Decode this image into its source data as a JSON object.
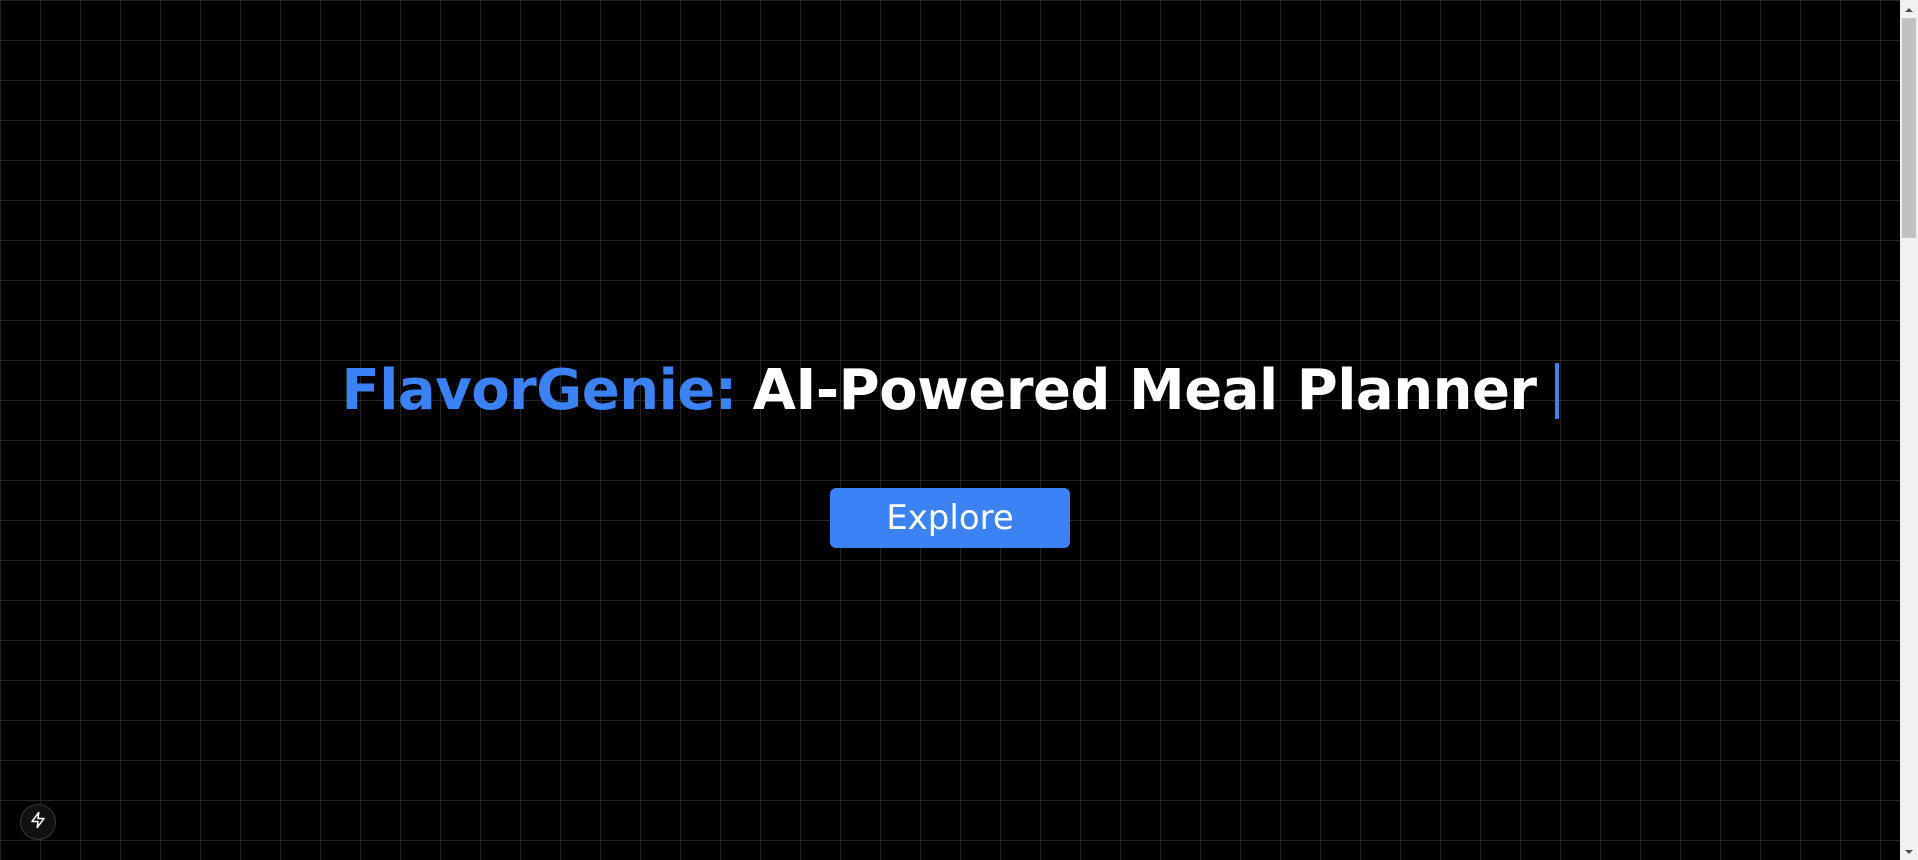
{
  "hero": {
    "brand": "FlavorGenie:",
    "tagline": "AI-Powered Meal Planner",
    "explore_label": "Explore"
  },
  "icons": {
    "dev_indicator": "lightning-bolt-icon",
    "scroll_up": "chevron-up-icon",
    "scroll_down": "chevron-down-icon"
  },
  "colors": {
    "background": "#000000",
    "grid_line": "#262626",
    "accent": "#3b82f6",
    "heading_text": "#ffffff"
  }
}
